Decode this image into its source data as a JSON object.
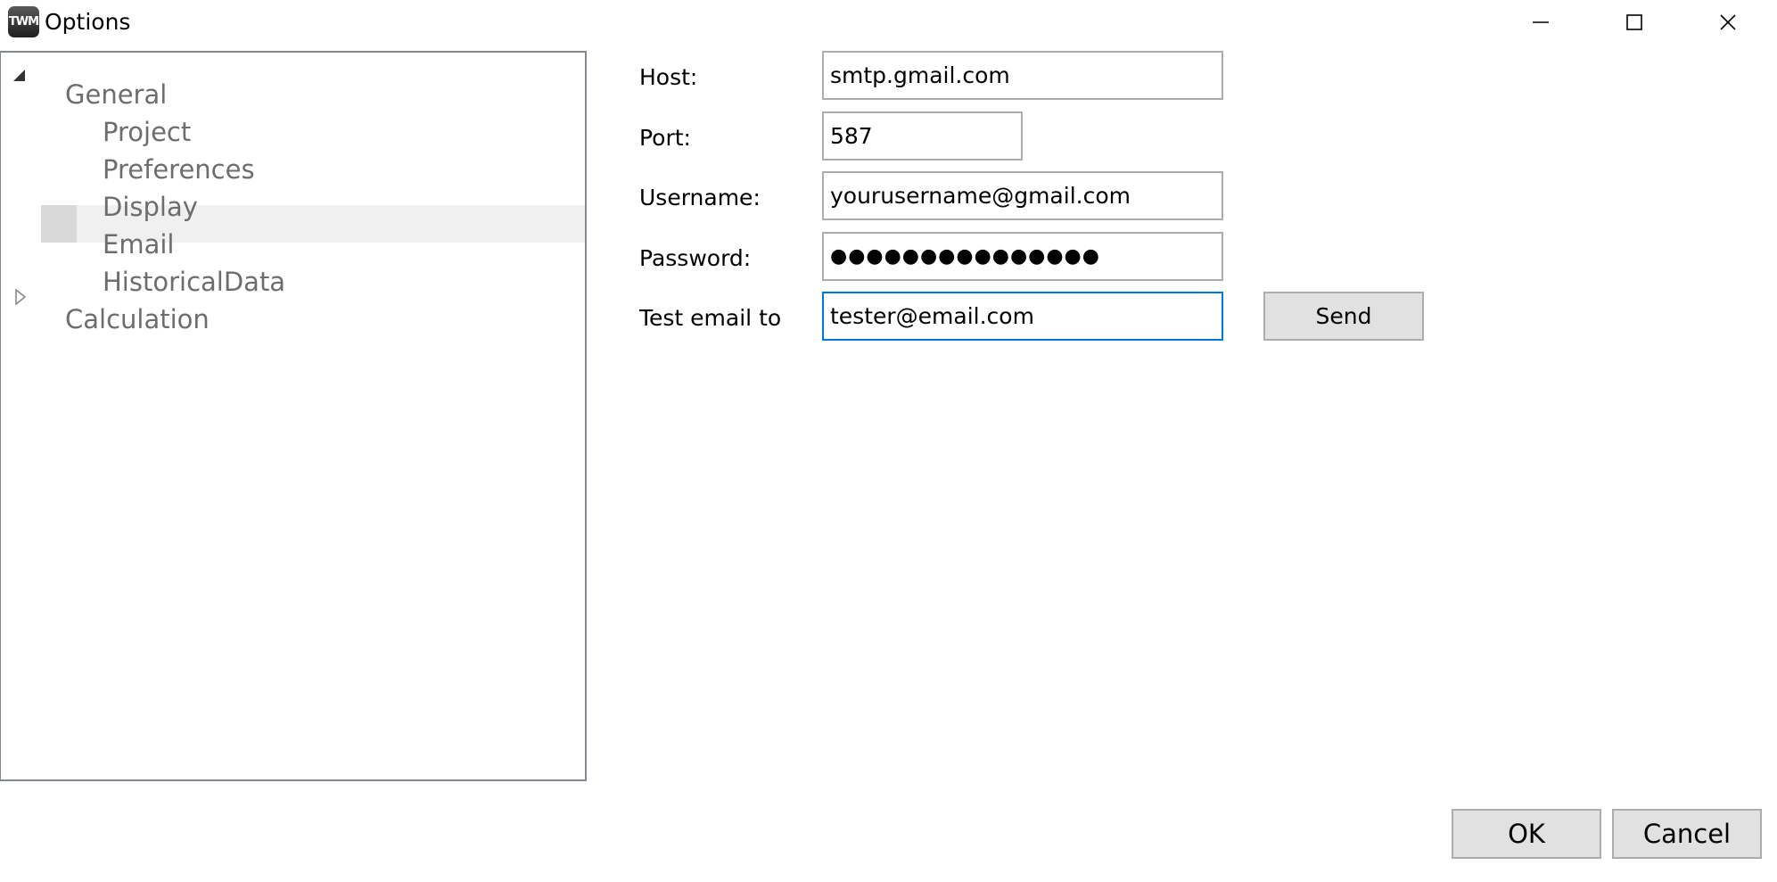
{
  "window": {
    "title": "Options",
    "icon_text": "TWM",
    "controls": {
      "minimize_icon": "minimize-icon",
      "maximize_icon": "maximize-icon",
      "close_icon": "close-icon"
    }
  },
  "tree": {
    "nodes": [
      {
        "label": "General",
        "expanded": true,
        "level": 0
      },
      {
        "label": "Project",
        "level": 1
      },
      {
        "label": "Preferences",
        "level": 1
      },
      {
        "label": "Display",
        "level": 1
      },
      {
        "label": "Email",
        "level": 1,
        "selected": true
      },
      {
        "label": "HistoricalData",
        "level": 1
      },
      {
        "label": "Calculation",
        "expanded": false,
        "level": 0
      }
    ]
  },
  "email_form": {
    "host_label": "Host:",
    "host_value": "smtp.gmail.com",
    "port_label": "Port:",
    "port_value": "587",
    "username_label": "Username:",
    "username_value": "yourusername@gmail.com",
    "password_label": "Password:",
    "password_value": "●●●●●●●●●●●●●●●",
    "test_email_label": "Test email to",
    "test_email_value": "tester@email.com",
    "send_label": "Send"
  },
  "footer": {
    "ok_label": "OK",
    "cancel_label": "Cancel"
  },
  "colors": {
    "focus_border": "#0078d7",
    "tree_text": "#6d6d6d",
    "button_bg": "#e1e1e1",
    "selection_bg": "#f0f0f0"
  }
}
